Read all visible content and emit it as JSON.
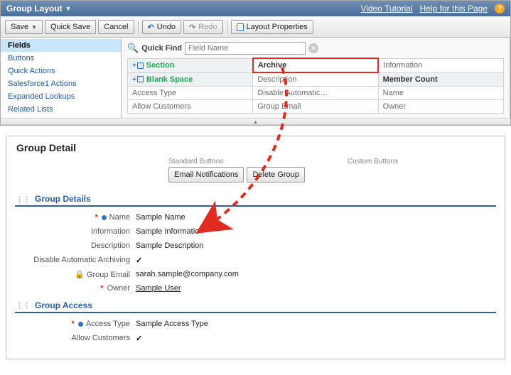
{
  "header": {
    "title": "Group Layout",
    "links": {
      "video": "Video Tutorial",
      "help": "Help for this Page"
    }
  },
  "toolbar": {
    "save": "Save",
    "quick_save": "Quick Save",
    "cancel": "Cancel",
    "undo": "Undo",
    "redo": "Redo",
    "layout_props": "Layout Properties"
  },
  "leftnav": {
    "items": [
      "Fields",
      "Buttons",
      "Quick Actions",
      "Salesforce1 Actions",
      "Expanded Lookups",
      "Related Lists"
    ],
    "selected_index": 0
  },
  "quickfind": {
    "label": "Quick Find",
    "placeholder": "Field Name"
  },
  "palette": {
    "rows": [
      [
        "Section",
        "Archive",
        "Information"
      ],
      [
        "Blank Space",
        "Description",
        "Member Count"
      ],
      [
        "Access Type",
        "Disable Automatic…",
        "Name"
      ],
      [
        "Allow Customers",
        "Group Email",
        "Owner"
      ]
    ],
    "highlight": {
      "r": 0,
      "c": 1
    },
    "shaded": [
      {
        "r": 0,
        "c": 0
      },
      {
        "r": 1,
        "c": 0
      },
      {
        "r": 1,
        "c": 2
      }
    ]
  },
  "canvas": {
    "title": "Group Detail",
    "button_groups": {
      "standard": {
        "label": "Standard Buttons",
        "buttons": [
          "Email Notifications",
          "Delete Group"
        ]
      },
      "custom": {
        "label": "Custom Buttons",
        "buttons": []
      }
    },
    "sections": [
      {
        "title": "Group Details",
        "fields": [
          {
            "label": "Name",
            "value": "Sample Name",
            "required": true,
            "bluedot": true
          },
          {
            "label": "Information",
            "value": "Sample Information"
          },
          {
            "label": "Description",
            "value": "Sample Description"
          },
          {
            "label": "Disable Automatic Archiving",
            "value": "",
            "check": true
          },
          {
            "label": "Group Email",
            "value": "sarah.sample@company.com",
            "lock": true
          },
          {
            "label": "Owner",
            "value": "Sample User",
            "required": true,
            "underline": true
          }
        ]
      },
      {
        "title": "Group Access",
        "fields": [
          {
            "label": "Access Type",
            "value": "Sample Access Type",
            "required": true,
            "bluedot": true
          },
          {
            "label": "Allow Customers",
            "value": "",
            "check": true
          }
        ]
      }
    ]
  }
}
